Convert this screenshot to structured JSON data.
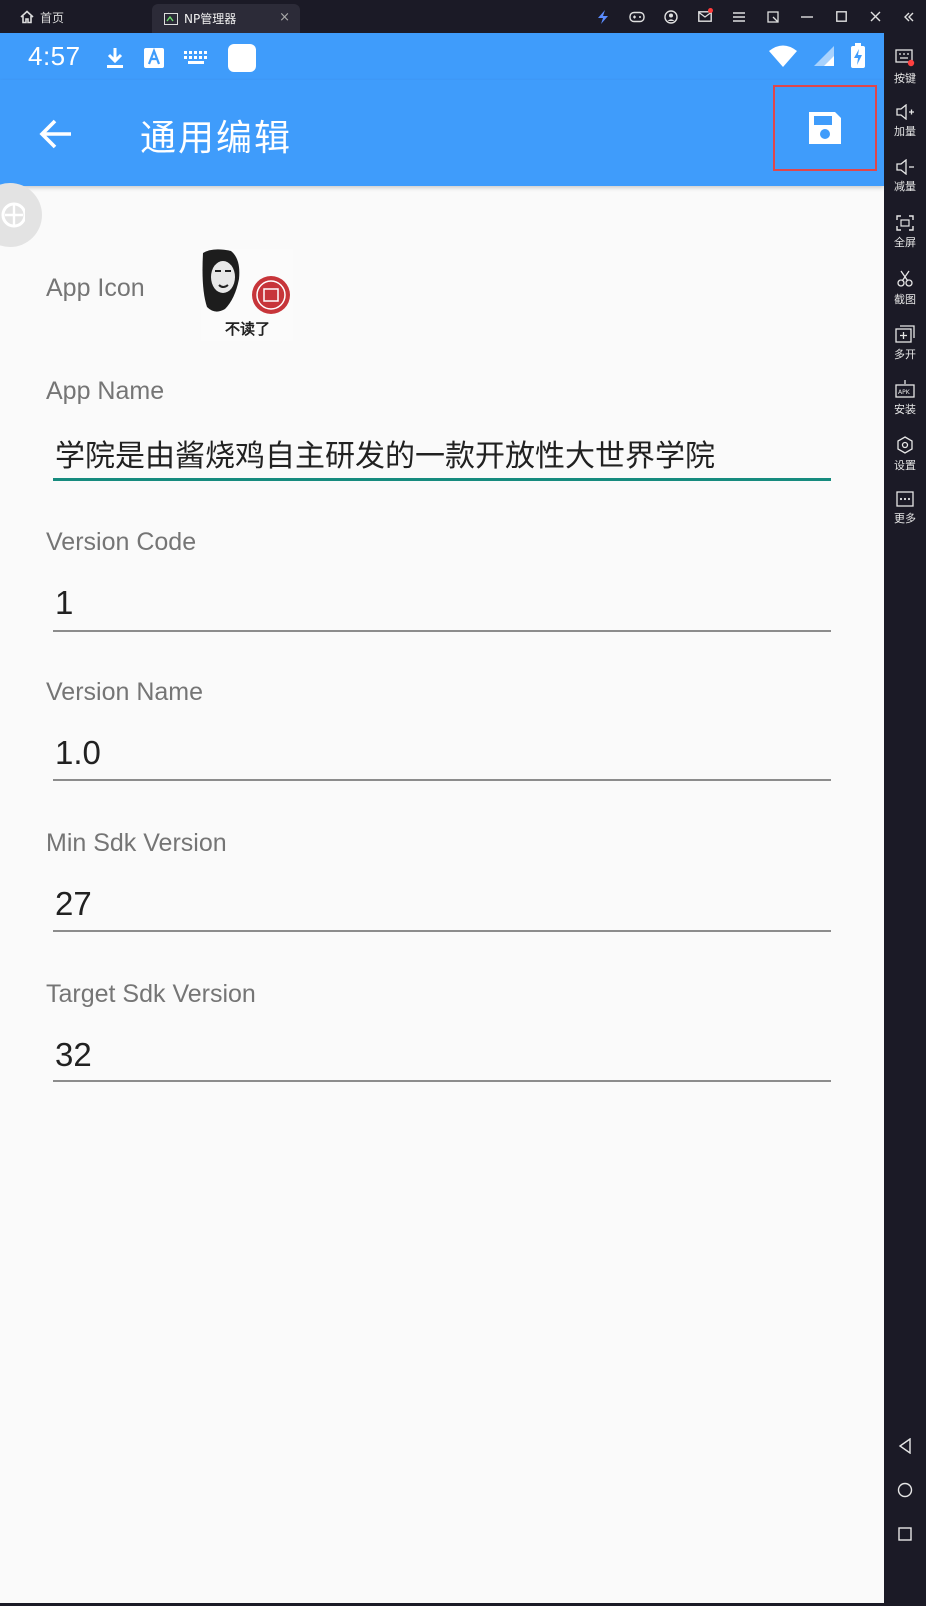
{
  "window": {
    "home_label": "首页",
    "tab_label": "NP管理器",
    "tab_close": "×"
  },
  "status_bar": {
    "time": "4:57"
  },
  "app_bar": {
    "title": "通用编辑",
    "back_icon": "arrow-left-icon",
    "save_icon": "floppy-disk-icon"
  },
  "form": {
    "app_icon_label": "App Icon",
    "app_icon_caption": "不读了",
    "app_name_label": "App Name",
    "app_name_value": "学院是由酱烧鸡自主研发的一款开放性大世界学院",
    "version_code_label": "Version Code",
    "version_code_value": "1",
    "version_name_label": "Version Name",
    "version_name_value": "1.0",
    "min_sdk_label": "Min Sdk Version",
    "min_sdk_value": "27",
    "target_sdk_label": "Target Sdk Version",
    "target_sdk_value": "32"
  },
  "sidebar": {
    "items": [
      {
        "label": "按键",
        "icon": "keyboard-icon"
      },
      {
        "label": "加量",
        "icon": "volume-up-icon"
      },
      {
        "label": "减量",
        "icon": "volume-down-icon"
      },
      {
        "label": "全屏",
        "icon": "fullscreen-icon"
      },
      {
        "label": "截图",
        "icon": "scissors-icon"
      },
      {
        "label": "多开",
        "icon": "multi-instance-icon"
      },
      {
        "label": "安装",
        "icon": "apk-install-icon"
      },
      {
        "label": "设置",
        "icon": "settings-icon"
      },
      {
        "label": "更多",
        "icon": "more-icon"
      }
    ]
  },
  "colors": {
    "primary": "#3f9cfb",
    "accent_underline": "#168b7e",
    "highlight_border": "#e0474b"
  }
}
